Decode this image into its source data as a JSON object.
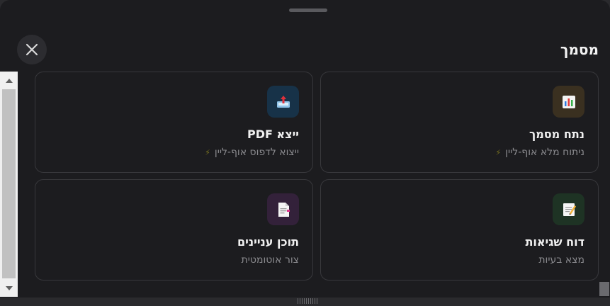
{
  "sheet": {
    "title": "מסמך",
    "close_icon": "close-icon"
  },
  "cards": [
    {
      "title": "ייצא PDF",
      "subtitle": "ייצוא לדפוס אוף-ליין",
      "offline_mark": "⚡",
      "icon": "export-upload-icon",
      "icon_bg": "#173248"
    },
    {
      "title": "נתח מסמך",
      "subtitle": "ניתוח מלא אוף-ליין",
      "offline_mark": "⚡",
      "icon": "bar-chart-icon",
      "icon_bg": "#3a3020"
    },
    {
      "title": "תוכן עניינים",
      "subtitle": "צור אוטומטית",
      "icon": "page-icon",
      "icon_bg": "#33213a"
    },
    {
      "title": "דוח שגיאות",
      "subtitle": "מצא בעיות",
      "icon": "memo-icon",
      "icon_bg": "#1e3324"
    }
  ],
  "colors": {
    "sheet_bg": "#1c1c1f",
    "card_border": "#38383c",
    "offline_mark": "#7a7420"
  }
}
